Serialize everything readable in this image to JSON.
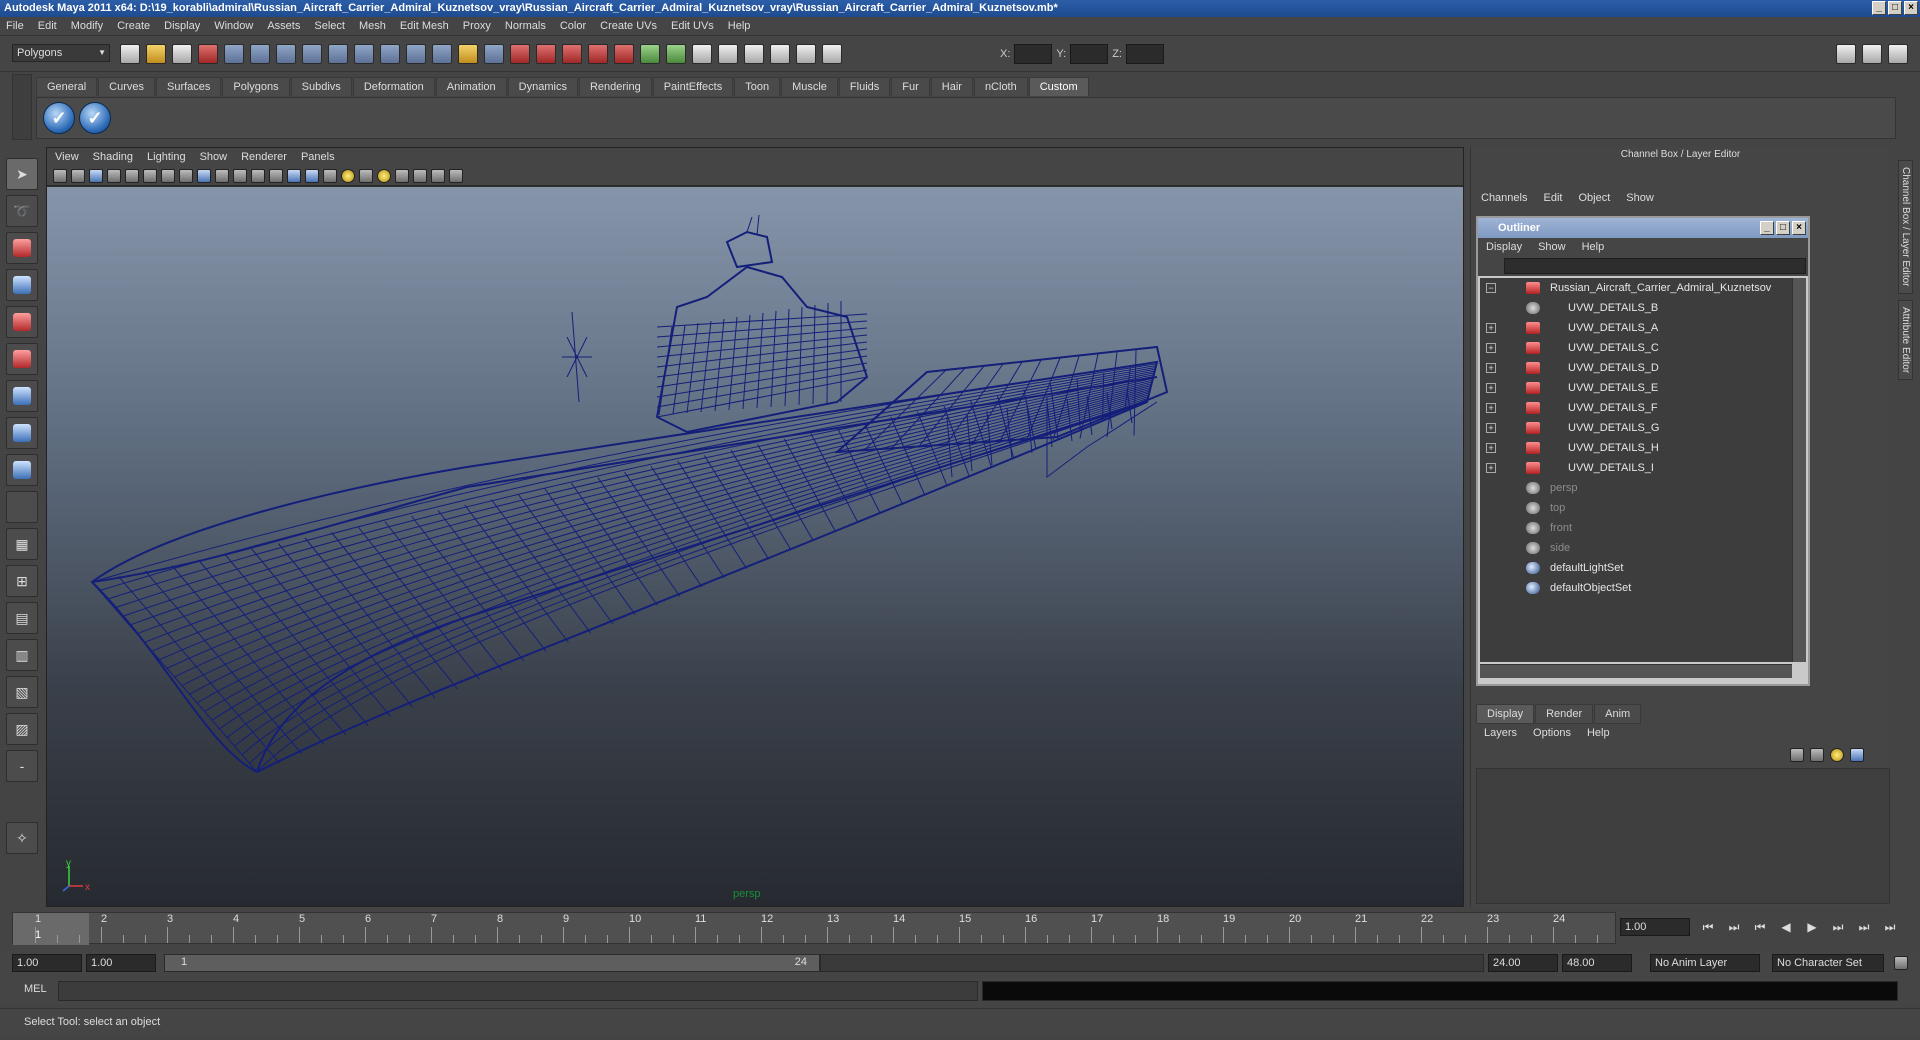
{
  "window": {
    "title": "Autodesk Maya 2011 x64: D:\\19_korabli\\admiral\\Russian_Aircraft_Carrier_Admiral_Kuznetsov_vray\\Russian_Aircraft_Carrier_Admiral_Kuznetsov_vray\\Russian_Aircraft_Carrier_Admiral_Kuznetsov.mb*",
    "controls": [
      "_",
      "□",
      "×"
    ]
  },
  "menubar": [
    "File",
    "Edit",
    "Modify",
    "Create",
    "Display",
    "Window",
    "Assets",
    "Select",
    "Mesh",
    "Edit Mesh",
    "Proxy",
    "Normals",
    "Color",
    "Create UVs",
    "Edit UVs",
    "Help"
  ],
  "statusline": {
    "mode": "Polygons",
    "x_label": "X:",
    "y_label": "Y:",
    "z_label": "Z:"
  },
  "shelf": {
    "tabs": [
      "General",
      "Curves",
      "Surfaces",
      "Polygons",
      "Subdivs",
      "Deformation",
      "Animation",
      "Dynamics",
      "Rendering",
      "PaintEffects",
      "Toon",
      "Muscle",
      "Fluids",
      "Fur",
      "Hair",
      "nCloth",
      "Custom"
    ],
    "active_tab": "Custom",
    "buttons": [
      "✓",
      "✓"
    ]
  },
  "panel": {
    "menu": [
      "View",
      "Shading",
      "Lighting",
      "Show",
      "Renderer",
      "Panels"
    ],
    "camera_label": "persp",
    "axis_y": "y",
    "axis_x": "x",
    "wire_color": "#141f7a"
  },
  "channelbox": {
    "title": "Channel Box / Layer Editor",
    "menu": [
      "Channels",
      "Edit",
      "Object",
      "Show"
    ],
    "side_tabs": [
      "Channel Box / Layer Editor",
      "Attribute Editor"
    ]
  },
  "outliner": {
    "title": "Outliner",
    "menu": [
      "Display",
      "Show",
      "Help"
    ],
    "root": "Russian_Aircraft_Carrier_Admiral_Kuznetsov",
    "children": [
      "UVW_DETAILS_B",
      "UVW_DETAILS_A",
      "UVW_DETAILS_C",
      "UVW_DETAILS_D",
      "UVW_DETAILS_E",
      "UVW_DETAILS_F",
      "UVW_DETAILS_G",
      "UVW_DETAILS_H",
      "UVW_DETAILS_I"
    ],
    "cameras": [
      "persp",
      "top",
      "front",
      "side"
    ],
    "sets": [
      "defaultLightSet",
      "defaultObjectSet"
    ]
  },
  "layers": {
    "tabs": [
      "Display",
      "Render",
      "Anim"
    ],
    "active_tab": "Display",
    "menu": [
      "Layers",
      "Options",
      "Help"
    ]
  },
  "timeline": {
    "ticks": [
      "1",
      "2",
      "3",
      "4",
      "5",
      "6",
      "7",
      "8",
      "9",
      "10",
      "11",
      "12",
      "13",
      "14",
      "15",
      "16",
      "17",
      "18",
      "19",
      "20",
      "21",
      "22",
      "23",
      "24"
    ],
    "current_frame": "1",
    "current_field": "1.00",
    "playback": [
      "⏮",
      "⏭",
      "⏮",
      "◀",
      "▶",
      "⏭",
      "⏭",
      "⏭"
    ]
  },
  "range": {
    "start": "1.00",
    "playback_start": "1.00",
    "slider_start": "1",
    "slider_end": "24",
    "playback_end": "24.00",
    "end": "48.00",
    "anim_layer": "No Anim Layer",
    "character_set": "No Character Set"
  },
  "command": {
    "label": "MEL"
  },
  "help": {
    "text": "Select Tool: select an object"
  }
}
